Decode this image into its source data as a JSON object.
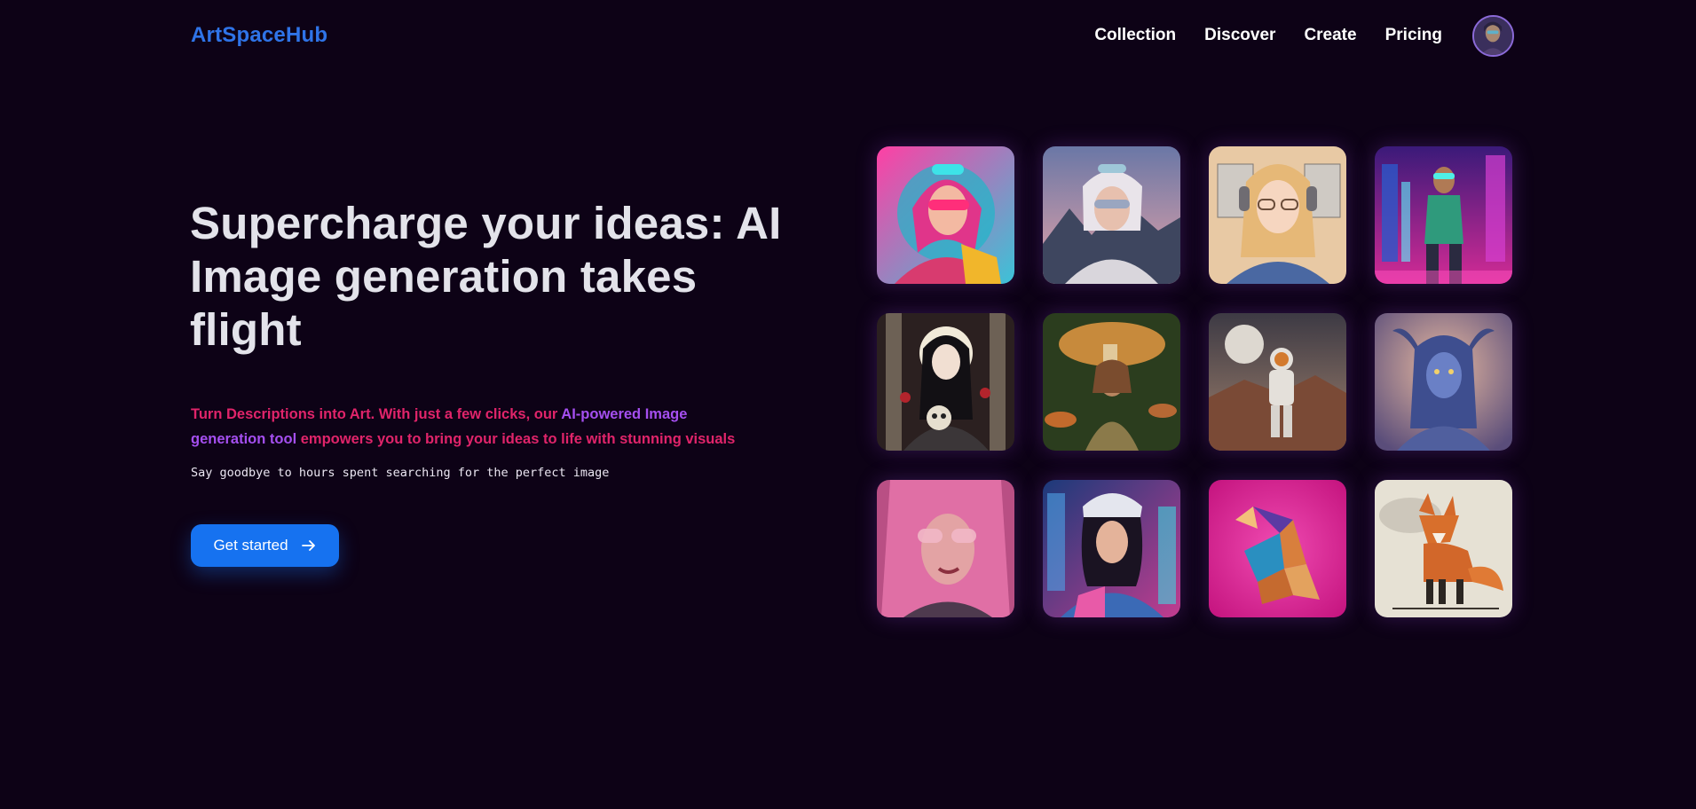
{
  "nav": {
    "logo": "ArtSpaceHub",
    "links": [
      "Collection",
      "Discover",
      "Create",
      "Pricing"
    ]
  },
  "hero": {
    "title": "Supercharge your ideas: AI Image generation takes flight",
    "subtitle_part1": "Turn Descriptions into Art. With just a few clicks, our ",
    "subtitle_highlight": "AI-powered Image generation tool",
    "subtitle_part2": " empowers you to bring your ideas to life with stunning visuals",
    "mono": "Say goodbye to hours spent searching for the perfect image",
    "cta": "Get started"
  },
  "gallery": {
    "images": [
      "cyberpunk-girl-pink-hair-goggles",
      "woman-mountains-white-hair",
      "anime-girl-headphones-glasses",
      "neon-city-cyborg-woman",
      "gothic-woman-skull",
      "woman-giant-mushroom-forest",
      "astronaut-desert-planet",
      "blue-horned-demon-woman",
      "pink-hair-woman-sunglasses",
      "cyberpunk-woman-cap",
      "origami-dragon-magenta",
      "ink-fox-illustration"
    ]
  },
  "colors": {
    "background": "#0d0216",
    "logo": "#2f74e8",
    "accent_pink": "#e0246a",
    "accent_purple": "#a54ff0",
    "button": "#1672f0"
  }
}
